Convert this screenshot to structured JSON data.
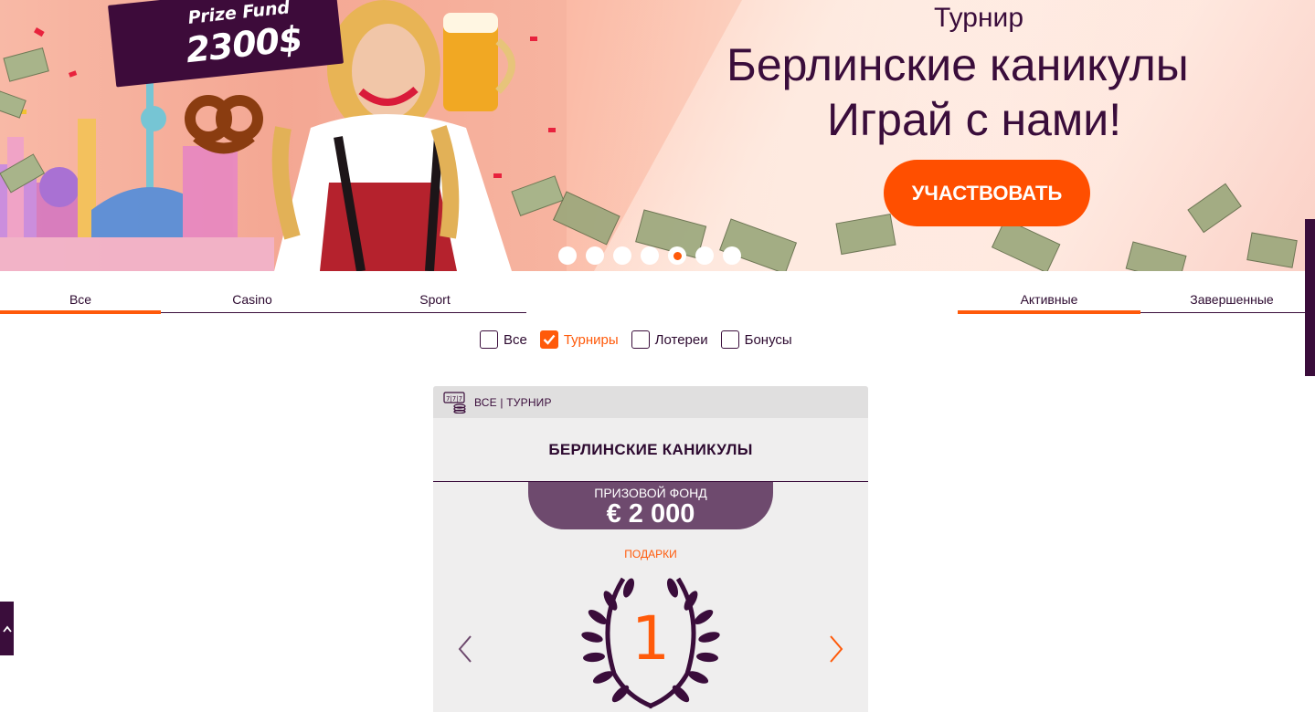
{
  "banner": {
    "prize_fund_label": "Prize Fund",
    "prize_fund_amount": "2300$",
    "subtitle": "Турнир",
    "title_line1": "Берлинские каникулы",
    "title_line2": "Играй с нами!",
    "cta_label": "УЧАСТВОВАТЬ",
    "slides_count": 7,
    "active_slide": 5,
    "accent_color": "#ff4f00"
  },
  "category_tabs": [
    {
      "label": "Все",
      "active": true
    },
    {
      "label": "Casino",
      "active": false
    },
    {
      "label": "Sport",
      "active": false
    }
  ],
  "status_tabs": [
    {
      "label": "Активные",
      "active": true
    },
    {
      "label": "Завершенные",
      "active": false
    }
  ],
  "filters": [
    {
      "label": "Все",
      "checked": false
    },
    {
      "label": "Турниры",
      "checked": true
    },
    {
      "label": "Лотереи",
      "checked": false
    },
    {
      "label": "Бонусы",
      "checked": false
    }
  ],
  "card": {
    "icon": "slot-machine-icon",
    "tag": "ВСЕ | ТУРНИР",
    "title": "БЕРЛИНСКИЕ КАНИКУЛЫ",
    "prize_label": "ПРИЗОВОЙ ФОНД",
    "prize_value": "€ 2 000",
    "gifts_label": "ПОДАРКИ",
    "place": "1"
  },
  "colors": {
    "brand_dark": "#3a0d3b",
    "accent": "#ff5a0a",
    "pill": "#6e4a6e"
  }
}
